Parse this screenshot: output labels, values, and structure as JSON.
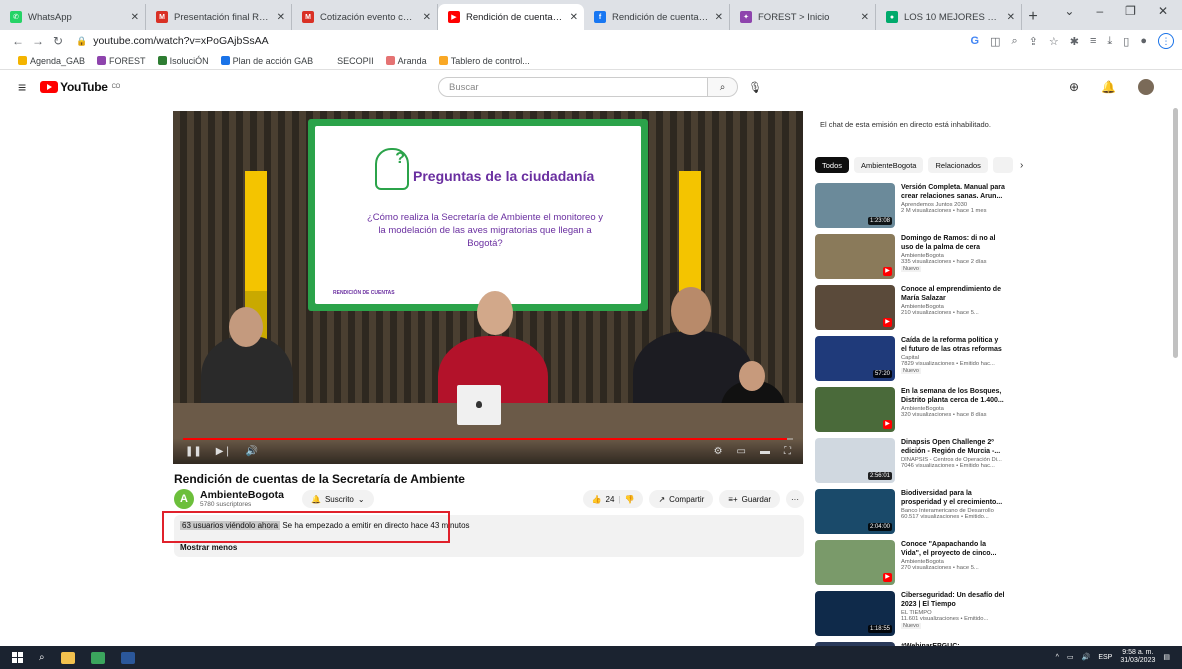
{
  "browser": {
    "tabs": [
      {
        "label": "WhatsApp",
        "fav_color": "#25d366",
        "fav_glyph": "✆",
        "active": false
      },
      {
        "label": "Presentación final Rendición de",
        "fav_color": "#d93025",
        "fav_glyph": "M",
        "active": false
      },
      {
        "label": "Cotización evento corporativo",
        "fav_color": "#d93025",
        "fav_glyph": "M",
        "active": false
      },
      {
        "label": "Rendición de cuentas de la",
        "fav_color": "#ff0000",
        "fav_glyph": "▶",
        "active": true
      },
      {
        "label": "Rendición de cuentas Secretaria",
        "fav_color": "#1877f2",
        "fav_glyph": "f",
        "active": false
      },
      {
        "label": "FOREST > Inicio",
        "fav_color": "#8e44ad",
        "fav_glyph": "✦",
        "active": false
      },
      {
        "label": "LOS 10 MEJORES hoteles cerca",
        "fav_color": "#00aa6c",
        "fav_glyph": "●",
        "active": false
      }
    ],
    "url": "youtube.com/watch?v=xPoGAjbSsAA",
    "bookmarks": [
      {
        "label": "Agenda_GAB",
        "color": "#f4b400"
      },
      {
        "label": "FOREST",
        "color": "#8e44ad"
      },
      {
        "label": "IsoluciÓN",
        "color": "#2e7d32"
      },
      {
        "label": "Plan de acción GAB",
        "color": "#1a73e8"
      },
      {
        "label": "SECOPII",
        "color": "#ffffff"
      },
      {
        "label": "Aranda",
        "color": "#e57373"
      },
      {
        "label": "Tablero de control...",
        "color": "#f9a825"
      }
    ]
  },
  "youtube": {
    "logo_text": "YouTube",
    "logo_region": "CO",
    "search_placeholder": "Buscar"
  },
  "video": {
    "screen_title": "Preguntas de la ciudadanía",
    "screen_question": "¿Cómo realiza la Secretaría de Ambiente el monitoreo y la modelación de las aves migratorias que llegan a Bogotá?",
    "screen_footer": "RENDICIÓN DE CUENTAS",
    "title": "Rendición de cuentas de la Secretaría de Ambiente",
    "channel_name": "AmbienteBogota",
    "channel_initial": "A",
    "subscribers": "5780 suscriptores",
    "subscribed_label": "Suscrito",
    "likes": "24",
    "share_label": "Compartir",
    "save_label": "Guardar",
    "viewers_text": "63 usuarios viéndolo ahora",
    "live_text": "Se ha empezado a emitir en directo hace 43 minutos",
    "show_less": "Mostrar menos"
  },
  "sidebar": {
    "chat_disabled": "El chat de esta emisión en directo está inhabilitado.",
    "chips": [
      "Todos",
      "AmbienteBogota",
      "Relacionados"
    ],
    "recommendations": [
      {
        "title": "Versión Completa. Manual para crear relaciones sanas. Arun...",
        "channel": "Aprendemos Juntos 2030",
        "meta": "2 M visualizaciones • hace 1 mes",
        "duration": "1:23:08",
        "badge": "",
        "thumb": "#6b8a9a"
      },
      {
        "title": "Domingo de Ramos: di no al uso de la palma de cera",
        "channel": "AmbienteBogota",
        "meta": "335 visualizaciones • hace 2 días",
        "duration": "",
        "badge": "Nuevo",
        "thumb": "#8a7a5a"
      },
      {
        "title": "Conoce al emprendimiento de María Salazar",
        "channel": "AmbienteBogota",
        "meta": "210 visualizaciones • hace 5...",
        "duration": "",
        "badge": "",
        "thumb": "#5a4a3a"
      },
      {
        "title": "Caída de la reforma política y el futuro de las otras reformas |...",
        "channel": "Capital",
        "meta": "7829 visualizaciones • Emitido hac...",
        "duration": "57:20",
        "badge": "Nuevo",
        "thumb": "#1f3a7a"
      },
      {
        "title": "En la semana de los Bosques, Distrito planta cerca de 1.400...",
        "channel": "AmbienteBogota",
        "meta": "320 visualizaciones • hace 8 días",
        "duration": "",
        "badge": "",
        "thumb": "#4a6a3a"
      },
      {
        "title": "Dinapsis Open Challenge 2º edición - Región de Murcia -...",
        "channel": "DINAPSIS - Centros de Operación Di...",
        "meta": "7046 visualizaciones • Emitido hac...",
        "duration": "2:56:01",
        "badge": "",
        "thumb": "#d0d8e0"
      },
      {
        "title": "Biodiversidad para la prosperidad y el crecimiento...",
        "channel": "Banco Interamericano de Desarrollo",
        "meta": "60.517 visualizaciones • Emitido...",
        "duration": "2:04:00",
        "badge": "",
        "thumb": "#1a4a6a"
      },
      {
        "title": "Conoce \"Apapachando la Vida\", el proyecto de cinco...",
        "channel": "AmbienteBogota",
        "meta": "270 visualizaciones • hace 5...",
        "duration": "",
        "badge": "",
        "thumb": "#7a9a6a"
      },
      {
        "title": "Ciberseguridad: Un desafío del 2023 | El Tiempo",
        "channel": "EL TIEMPO",
        "meta": "11.601 visualizaciones • Emitido...",
        "duration": "1:18:55",
        "badge": "Nuevo",
        "thumb": "#0f2a4a"
      },
      {
        "title": "#WebinarEPGUC:",
        "channel": "",
        "meta": "",
        "duration": "",
        "badge": "",
        "thumb": "#2a3a5a"
      }
    ]
  },
  "taskbar": {
    "lang": "ESP",
    "time": "9:58 a. m.",
    "date": "31/03/2023"
  }
}
